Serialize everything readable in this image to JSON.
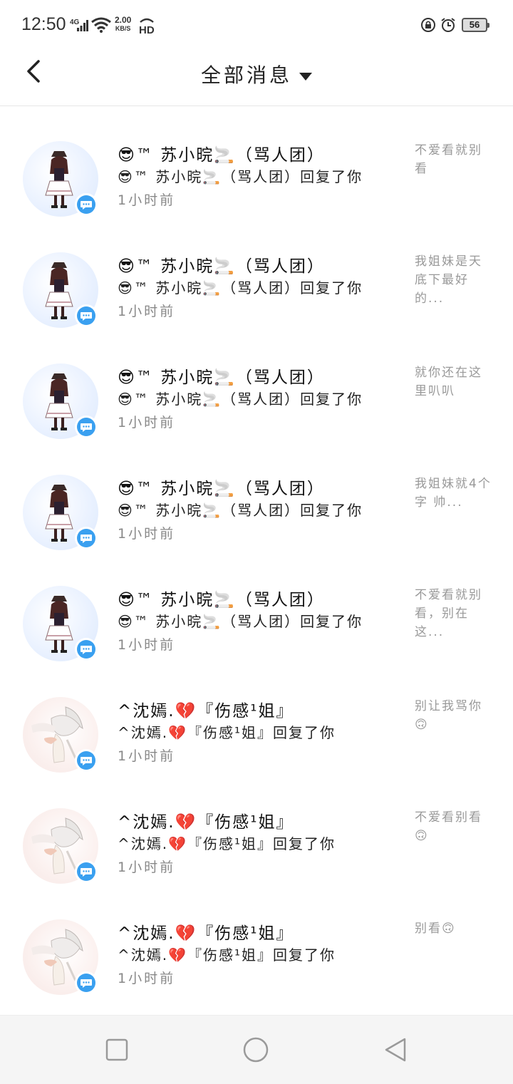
{
  "status_bar": {
    "time": "12:50",
    "network": "4G",
    "speed_value": "2.00",
    "speed_unit": "KB/S",
    "hd": "HD",
    "battery": "56"
  },
  "header": {
    "back_icon": "chevron-left-icon",
    "title": "全部消息",
    "dropdown_icon": "caret-down-icon"
  },
  "messages": [
    {
      "avatar": "girl-figure-avatar",
      "line1": "😎™ 苏小晥🚬（骂人团）",
      "line2": "😎™ 苏小晥🚬（骂人团）回复了你",
      "time": "1小时前",
      "quote": "不爱看就别看"
    },
    {
      "avatar": "girl-figure-avatar",
      "line1": "😎™ 苏小晥🚬（骂人团）",
      "line2": "😎™ 苏小晥🚬（骂人团）回复了你",
      "time": "1小时前",
      "quote": "我姐妹是天底下最好的..."
    },
    {
      "avatar": "girl-figure-avatar",
      "line1": "😎™ 苏小晥🚬（骂人团）",
      "line2": "😎™ 苏小晥🚬（骂人团）回复了你",
      "time": "1小时前",
      "quote": "就你还在这里叭叭"
    },
    {
      "avatar": "girl-figure-avatar",
      "line1": "😎™ 苏小晥🚬（骂人团）",
      "line2": "😎™ 苏小晥🚬（骂人团）回复了你",
      "time": "1小时前",
      "quote": "我姐妹就4个字 帅..."
    },
    {
      "avatar": "girl-figure-avatar",
      "line1": "😎™ 苏小晥🚬（骂人团）",
      "line2": "😎™ 苏小晥🚬（骂人团）回复了你",
      "time": "1小时前",
      "quote": "不爱看就别看，别在这..."
    },
    {
      "avatar": "white-hair-avatar",
      "line1": "^沈嫣.💔『伤感¹姐』",
      "line2": "^沈嫣.💔『伤感¹姐』回复了你",
      "time": "1小时前",
      "quote": "别让我骂你🙃"
    },
    {
      "avatar": "white-hair-avatar",
      "line1": "^沈嫣.💔『伤感¹姐』",
      "line2": "^沈嫣.💔『伤感¹姐』回复了你",
      "time": "1小时前",
      "quote": "不爱看别看🙃"
    },
    {
      "avatar": "white-hair-avatar",
      "line1": "^沈嫣.💔『伤感¹姐』",
      "line2": "^沈嫣.💔『伤感¹姐』回复了你",
      "time": "1小时前",
      "quote": "别看🙃"
    }
  ],
  "navbar": {
    "recent_icon": "square-icon",
    "home_icon": "circle-icon",
    "back_icon": "triangle-back-icon"
  },
  "colors": {
    "accent": "#3aa0f0",
    "secondary_text": "#999999",
    "navbar_bg": "#f5f5f5"
  }
}
